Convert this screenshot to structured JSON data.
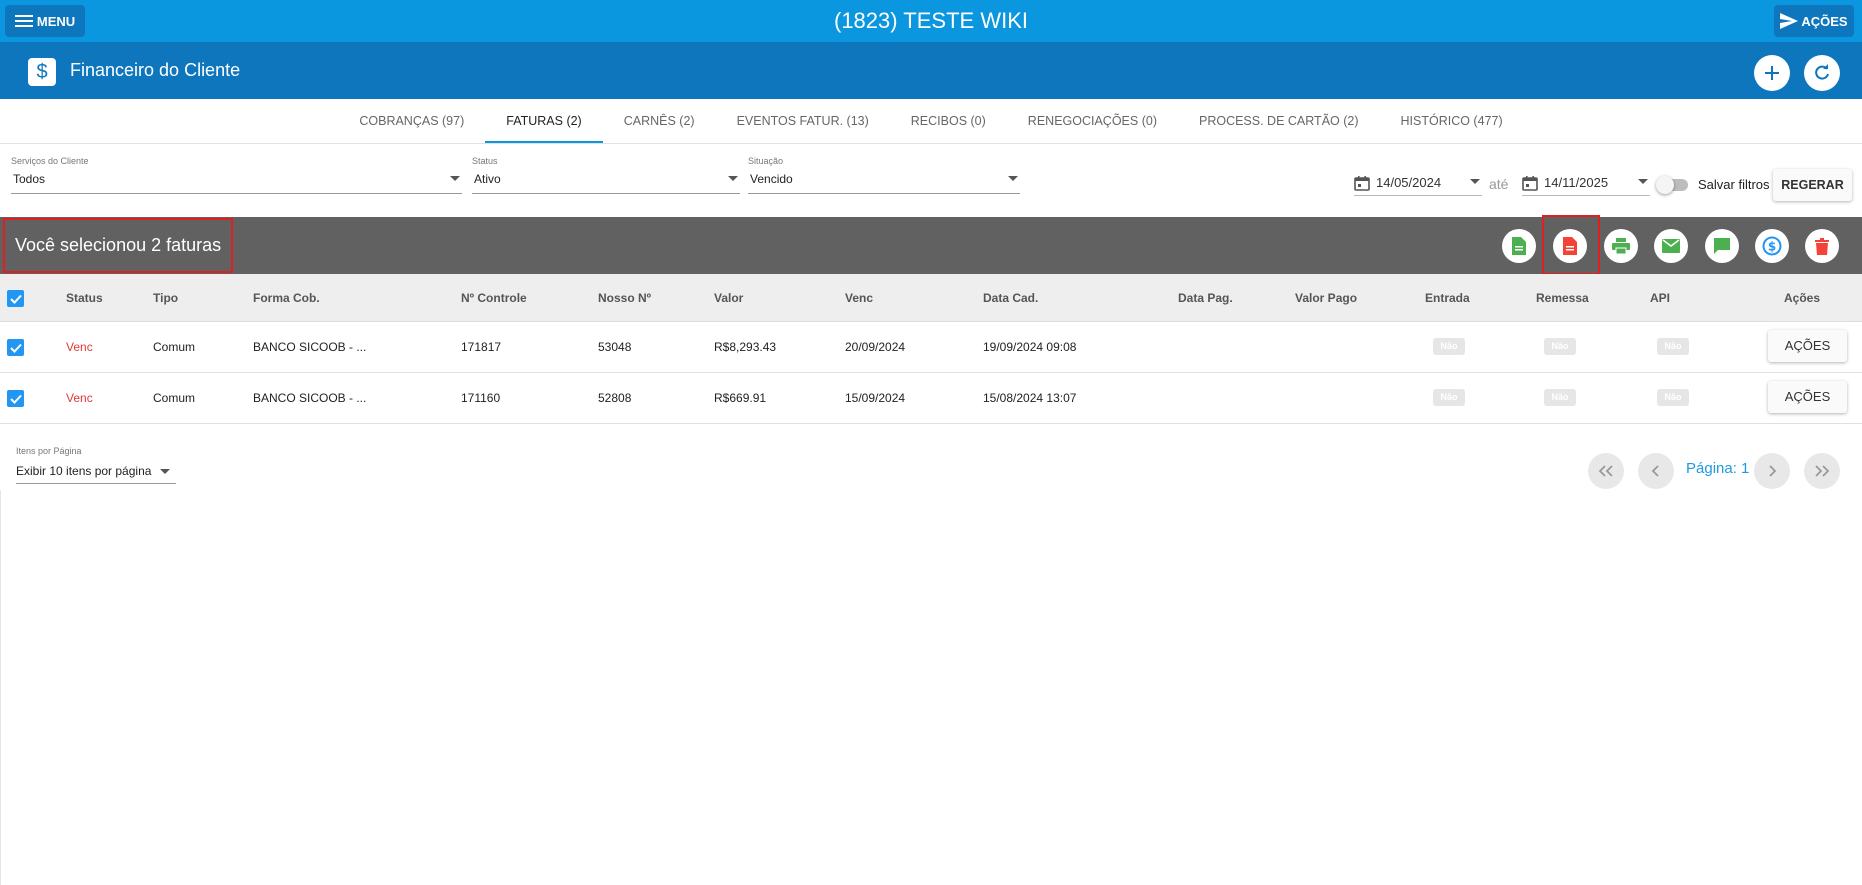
{
  "topbar": {
    "menu_label": "MENU",
    "title": "(1823) TESTE WIKI",
    "acoes_label": "AÇÕES"
  },
  "header": {
    "title": "Financeiro do Cliente",
    "icon": "dollar-icon"
  },
  "tabs": [
    {
      "label": "COBRANÇAS (97)",
      "active": false
    },
    {
      "label": "FATURAS (2)",
      "active": true
    },
    {
      "label": "CARNÊS (2)",
      "active": false
    },
    {
      "label": "EVENTOS FATUR. (13)",
      "active": false
    },
    {
      "label": "RECIBOS (0)",
      "active": false
    },
    {
      "label": "RENEGOCIAÇÕES (0)",
      "active": false
    },
    {
      "label": "PROCESS. DE CARTÃO (2)",
      "active": false
    },
    {
      "label": "HISTÓRICO (477)",
      "active": false
    }
  ],
  "filters": {
    "servicos": {
      "label": "Serviços do Cliente",
      "value": "Todos"
    },
    "status": {
      "label": "Status",
      "value": "Ativo"
    },
    "situacao": {
      "label": "Situação",
      "value": "Vencido"
    },
    "date_from": "14/05/2024",
    "ate": "até",
    "date_to": "14/11/2025",
    "salvar_filtros": "Salvar filtros",
    "regerar": "REGERAR"
  },
  "selection": {
    "text": "Você selecionou 2 faturas"
  },
  "table": {
    "headers": [
      "Status",
      "Tipo",
      "Forma Cob.",
      "Nº Controle",
      "Nosso Nº",
      "Valor",
      "Venc",
      "Data Cad.",
      "Data Pag.",
      "Valor Pago",
      "Entrada",
      "Remessa",
      "API",
      "Ações"
    ],
    "rows": [
      {
        "status": "Venc",
        "tipo": "Comum",
        "forma": "BANCO SICOOB - ...",
        "controle": "171817",
        "nosso": "53048",
        "valor": "R$8,293.43",
        "venc": "20/09/2024",
        "cad": "19/09/2024 09:08",
        "pag": "",
        "valor_pago": "",
        "entrada": "Não",
        "remessa": "Não",
        "api": "Não",
        "acoes": "AÇÕES"
      },
      {
        "status": "Venc",
        "tipo": "Comum",
        "forma": "BANCO SICOOB - ...",
        "controle": "171160",
        "nosso": "52808",
        "valor": "R$669.91",
        "venc": "15/09/2024",
        "cad": "15/08/2024 13:07",
        "pag": "",
        "valor_pago": "",
        "entrada": "Não",
        "remessa": "Não",
        "api": "Não",
        "acoes": "AÇÕES"
      }
    ]
  },
  "pagination": {
    "per_page_label": "Itens por Página",
    "per_page_value": "Exibir 10 itens por página",
    "page_label": "Página: 1"
  },
  "colors": {
    "topbar": "#0b97df",
    "header": "#0d76bd",
    "selection_bar": "#616161",
    "highlight": "#e02020",
    "green": "#4caf50",
    "red": "#f44336",
    "blue": "#2196f3"
  }
}
